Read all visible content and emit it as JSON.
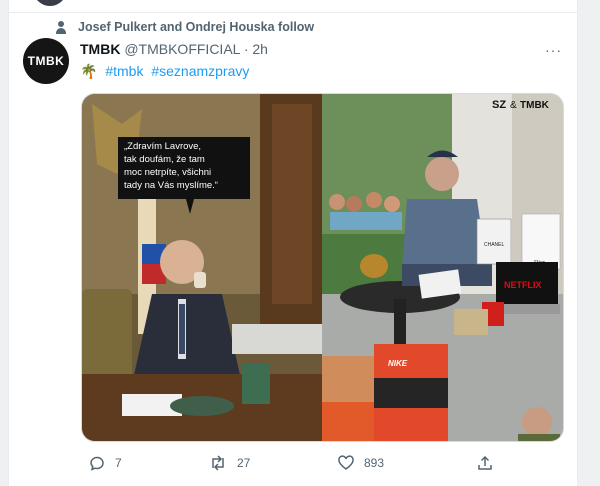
{
  "social_context": {
    "text": "Josef Pulkert and Ondrej Houska follow"
  },
  "tweet": {
    "avatar_text": "TMBK",
    "author_name": "TMBK",
    "handle": "@TMBKOFFICIAL",
    "separator": "·",
    "time": "2h",
    "more": "···",
    "palm_emoji": "🌴",
    "hashtags": [
      "#tmbk",
      "#seznamzpravy"
    ]
  },
  "media": {
    "speech_bubble": [
      "„Zdravím Lavrove,",
      "tak doufám, že tam",
      "moc netrpíte, všichni",
      "tady na Vás myslíme.“"
    ],
    "logo_sz": "SZ",
    "logo_amp": "&",
    "logo_tmbk": "TMBK",
    "netflix": "NETFLIX",
    "chanel": "CHANEL",
    "dior": "Dior",
    "nike": "NIKE"
  },
  "actions": {
    "reply_count": "7",
    "retweet_count": "27",
    "like_count": "893"
  },
  "colors": {
    "accent": "#1d9bf0",
    "muted": "#536471"
  }
}
